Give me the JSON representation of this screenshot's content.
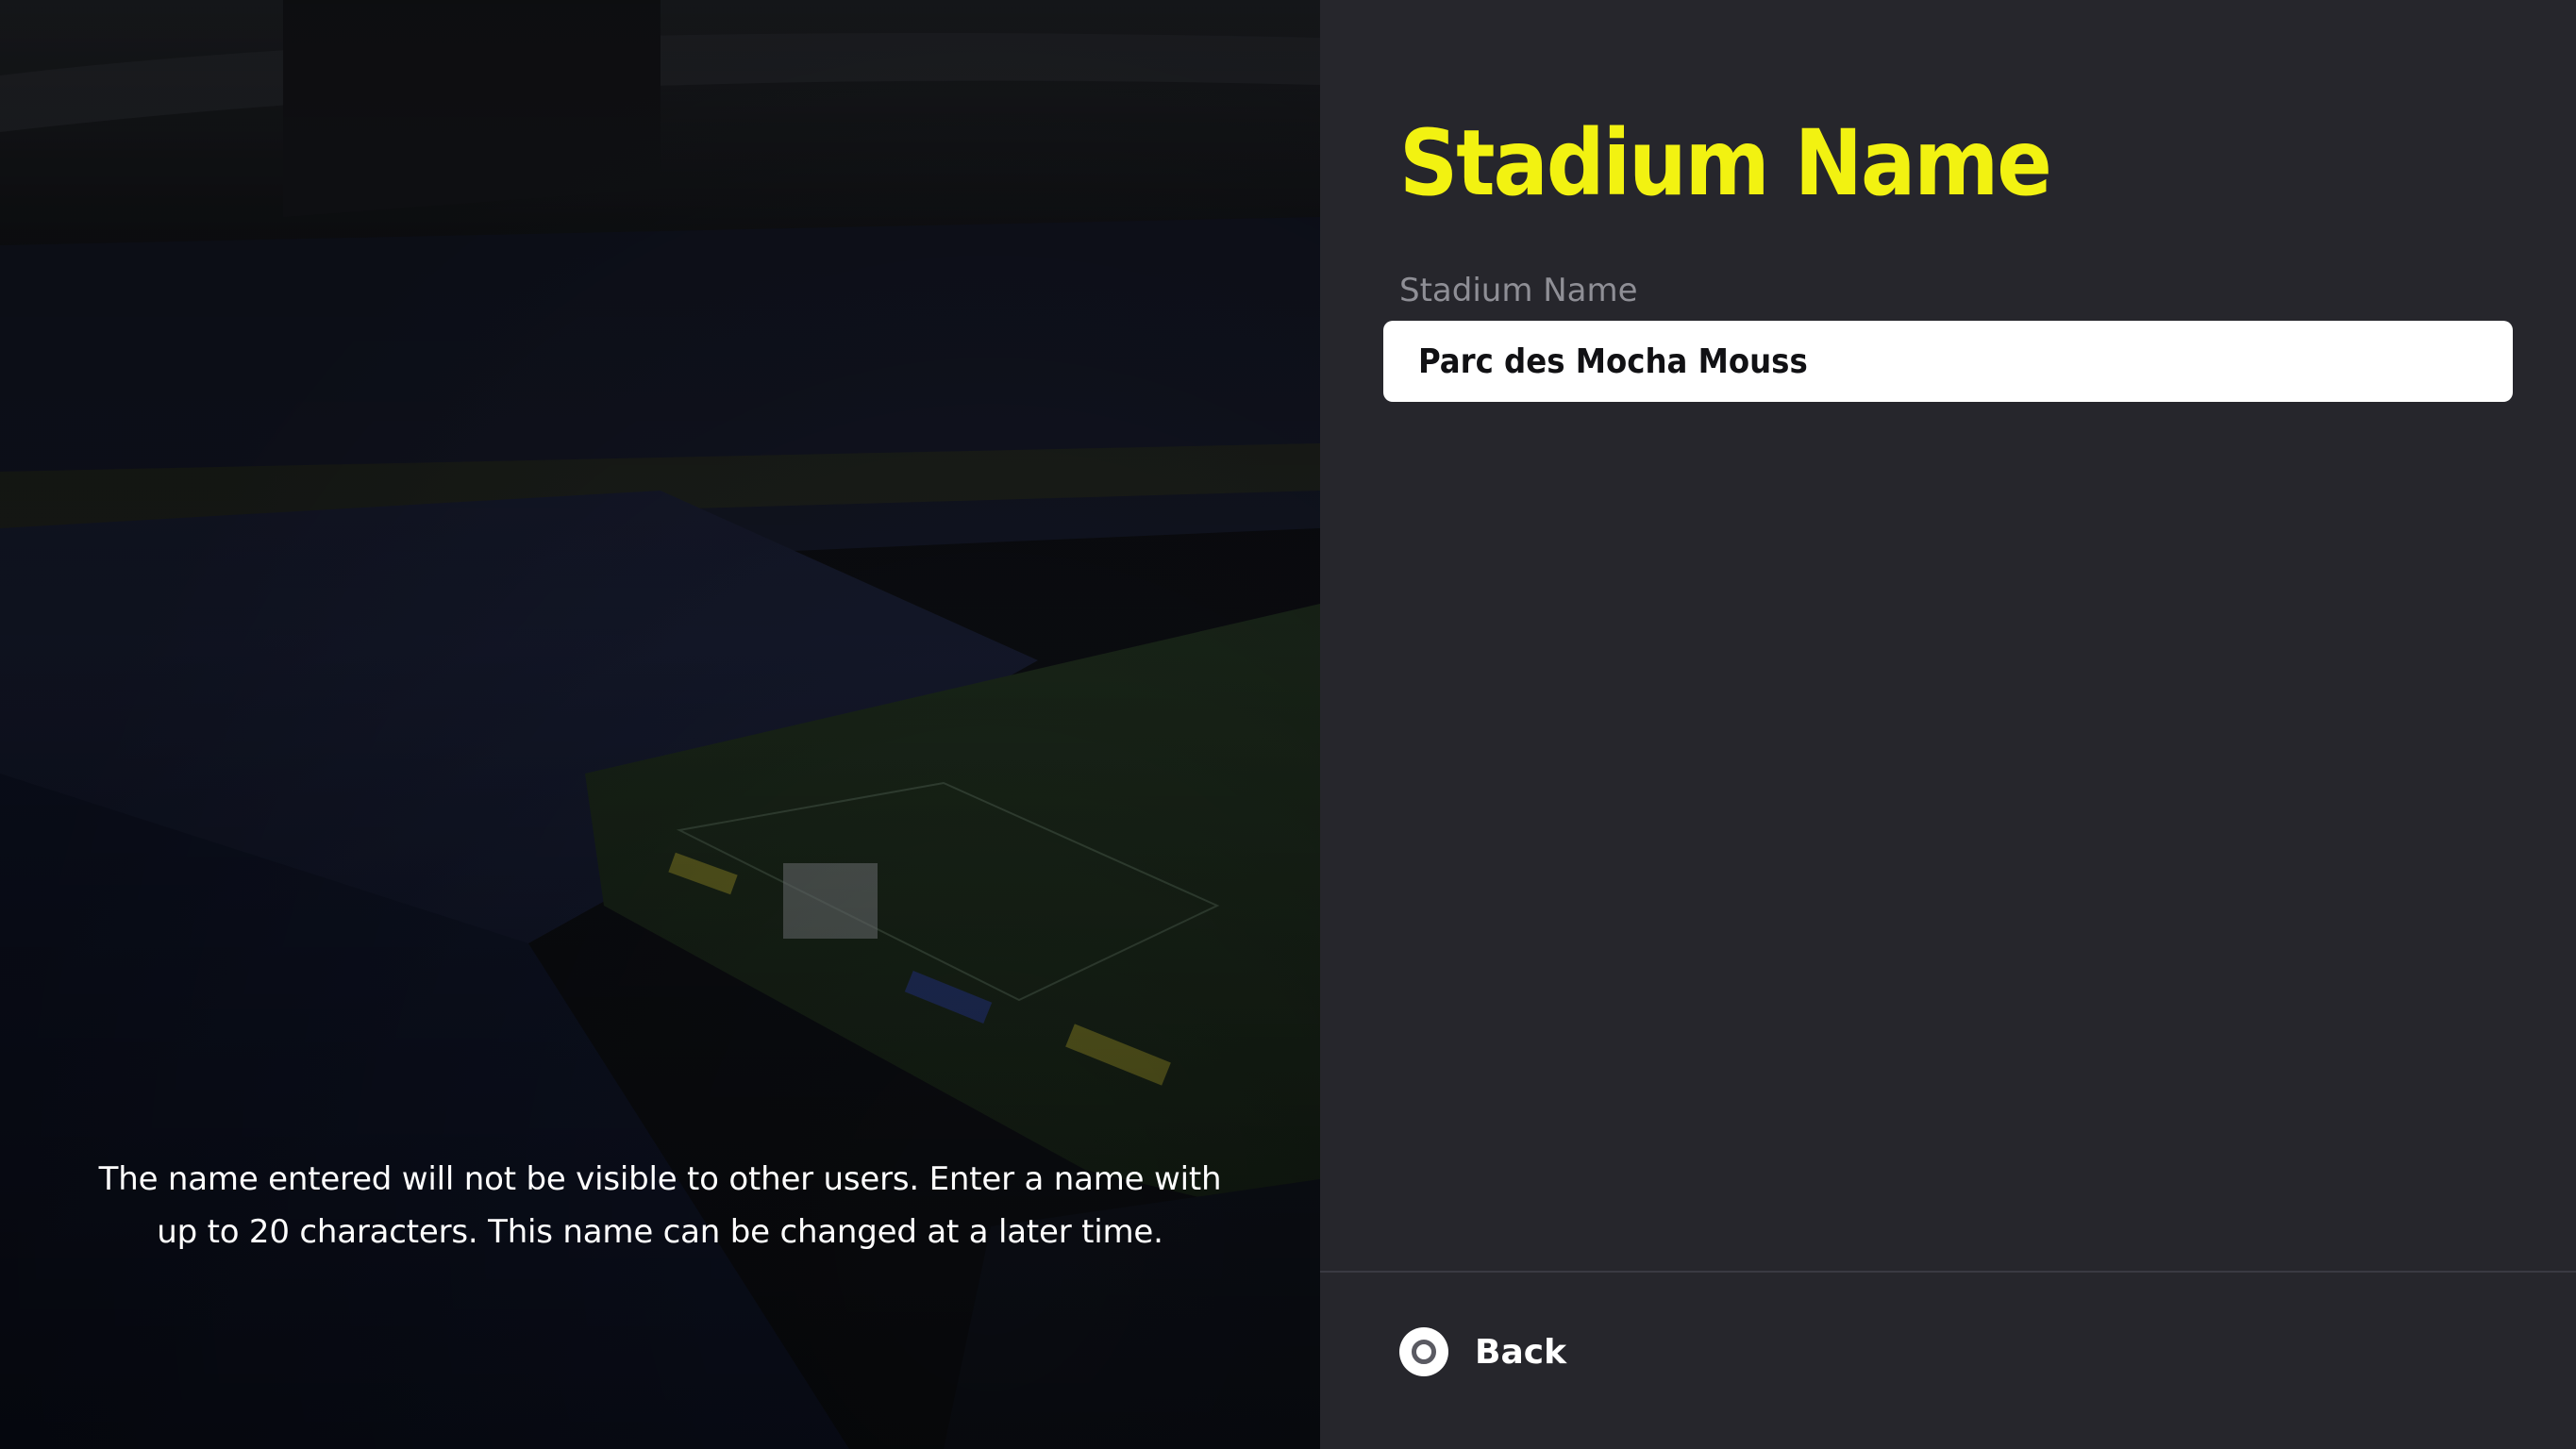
{
  "hint": {
    "text": "The name entered will not be visible to other users. Enter a name with up to 20 characters. This name can be changed at a later time."
  },
  "panel": {
    "title": "Stadium Name",
    "field_label": "Stadium Name",
    "field_value": "Parc des Mocha Mouss",
    "back_label": "Back",
    "back_icon": "circle-button-icon"
  },
  "colors": {
    "title": "#f2f211",
    "panel_bg": "#26262c",
    "field_bg": "#ffffff"
  }
}
